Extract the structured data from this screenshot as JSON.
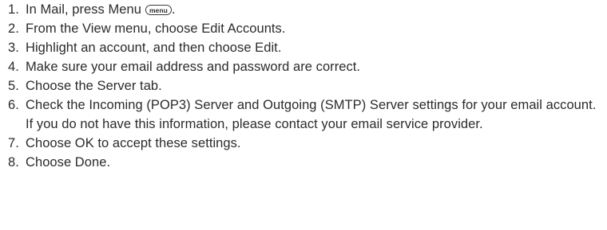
{
  "steps": [
    {
      "number": "1.",
      "text": "In Mail, press Menu",
      "key_icon": "menu",
      "suffix": "."
    },
    {
      "number": "2.",
      "text": "From the View menu, choose Edit Accounts."
    },
    {
      "number": "3.",
      "text": "Highlight an account, and then choose Edit."
    },
    {
      "number": "4.",
      "text": "Make sure your email address and password are correct."
    },
    {
      "number": "5.",
      "text": "Choose the Server tab."
    },
    {
      "number": "6.",
      "text": "Check the Incoming (POP3) Server and Outgoing (SMTP) Server settings for your email account. If you do not have this information, please contact your email service provider."
    },
    {
      "number": "7.",
      "text": "Choose OK to accept these settings."
    },
    {
      "number": "8.",
      "text": "Choose Done."
    }
  ]
}
